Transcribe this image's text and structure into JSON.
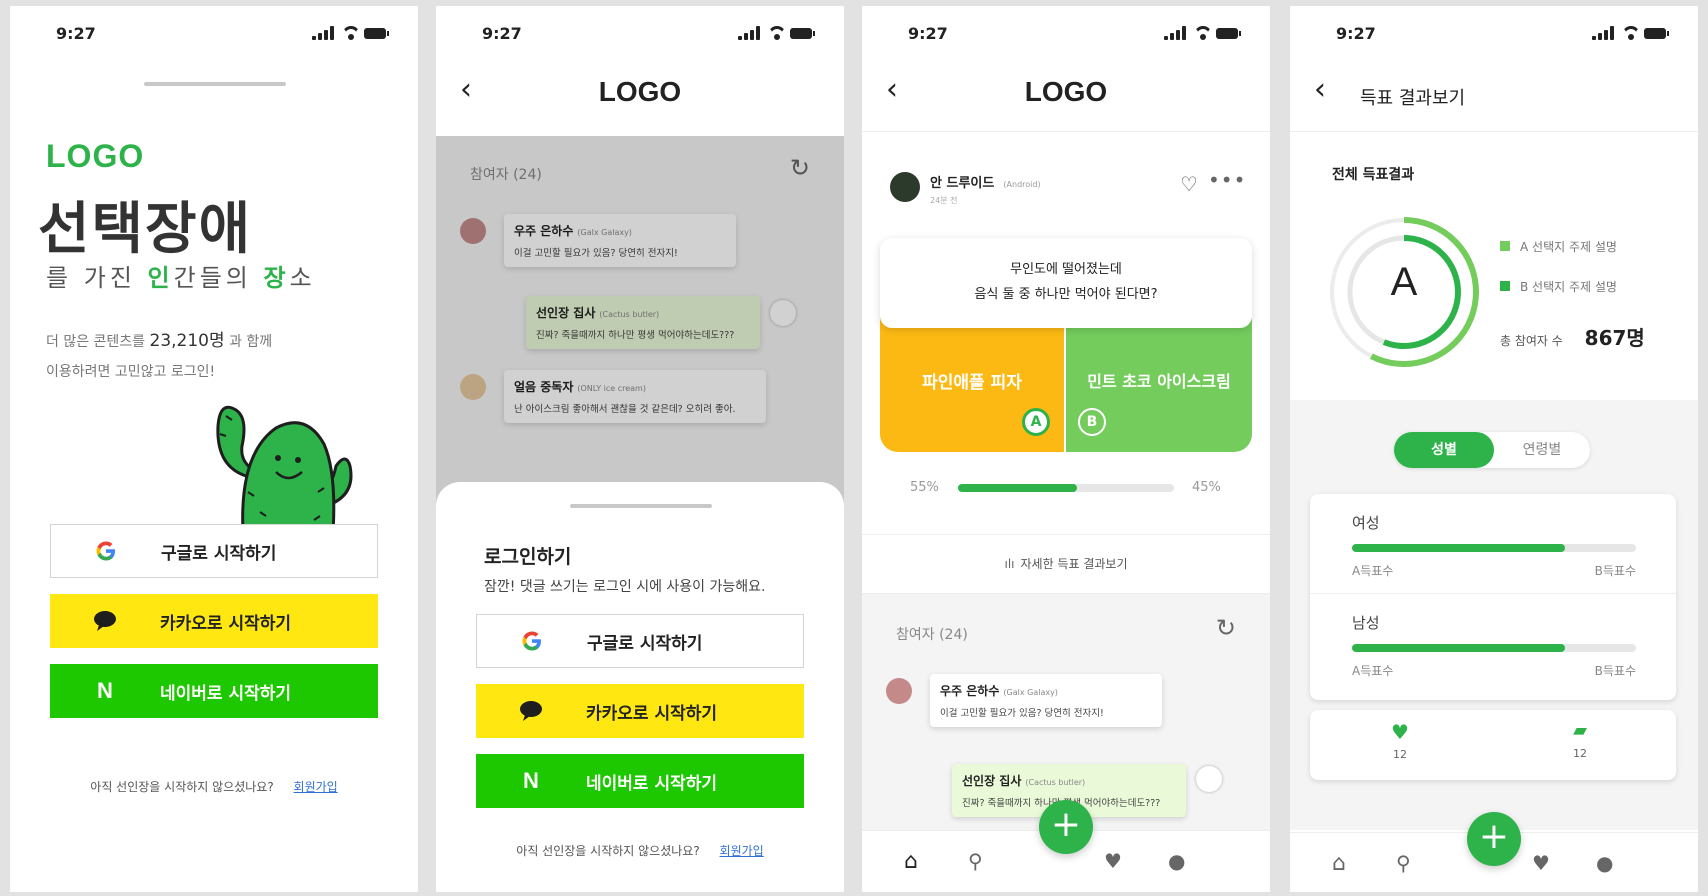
{
  "status": {
    "time": "9:27"
  },
  "screen1": {
    "logo": "LOGO",
    "headline": "선택장애",
    "sub": [
      "를",
      "가진",
      "인",
      "간들의",
      "장",
      "소"
    ],
    "desc1_a": "더 많은 콘텐츠를",
    "desc1_count": "23,210명",
    "desc1_b": "과 함께",
    "desc2": "이용하려면 고민않고 로그인!",
    "google": "구글로 시작하기",
    "kakao": "카카오로 시작하기",
    "naver": "네이버로 시작하기",
    "signup_q": "아직 선인장을 시작하지 않으셨나요?",
    "signup_link": "회원가입"
  },
  "screen2": {
    "logo": "LOGO",
    "participants": "참여자 (24)",
    "comments": [
      {
        "name": "우주 은하수",
        "device": "(Galx Galaxy)",
        "text": "이걸 고민할 필요가 있음? 당연히 전자지!"
      },
      {
        "name": "선인장 집사",
        "device": "(Cactus butler)",
        "text": "진짜? 죽을때까지 하나만 평생 먹어야하는데도???"
      },
      {
        "name": "얼음 중독자",
        "device": "(ONLY ice cream)",
        "text": "난 아이스크림 좋아해서 괜찮을 것 같은데? 오히려 좋아."
      }
    ],
    "sheet_title": "로그인하기",
    "sheet_desc": "잠깐! 댓글 쓰기는 로그인 시에 사용이 가능해요.",
    "google": "구글로 시작하기",
    "kakao": "카카오로 시작하기",
    "naver": "네이버로 시작하기",
    "signup_q": "아직 선인장을 시작하지 않으셨나요?",
    "signup_link": "회원가입"
  },
  "screen3": {
    "logo": "LOGO",
    "author": "안 드루이드",
    "author_device": "(Android)",
    "time_ago": "24분 전",
    "question1": "무인도에 떨어졌는데",
    "question2": "음식 둘 중 하나만 먹어야 된다면?",
    "optionA": "파인애플 피자",
    "optionB": "민트 초코 아이스크림",
    "badgeA": "A",
    "badgeB": "B",
    "pctA": "55%",
    "pctB": "45%",
    "ratioA": 0.55,
    "detail": "자세한 득표 결과보기",
    "participants": "참여자 (24)",
    "comments": [
      {
        "name": "우주 은하수",
        "device": "(Galx Galaxy)",
        "text": "이걸 고민할 필요가 있음? 당연히 전자지!"
      },
      {
        "name": "선인장 집사",
        "device": "(Cactus butler)",
        "text": "진짜? 죽을때까지 하나만 평생 먹어야하는데도???"
      }
    ]
  },
  "screen4": {
    "title": "득표 결과보기",
    "section": "전체 득표결과",
    "center": "A",
    "legendA": "A 선택지 주제 설명",
    "legendB": "B 선택지 주제 설명",
    "total_label": "총 참여자 수",
    "total": "867명",
    "tab_gender": "성별",
    "tab_age": "연령별",
    "groups": [
      {
        "label": "여성",
        "a": "A득표수",
        "b": "B득표수",
        "ratio": 0.75
      },
      {
        "label": "남성",
        "a": "A득표수",
        "b": "B득표수",
        "ratio": 0.75
      }
    ],
    "likes": "12",
    "comments": "12"
  },
  "colors": {
    "green": "#2db34a",
    "yellow": "#ffe812",
    "naver": "#1ec800",
    "orange": "#fdb913",
    "lightgreen": "#74cc5c"
  }
}
